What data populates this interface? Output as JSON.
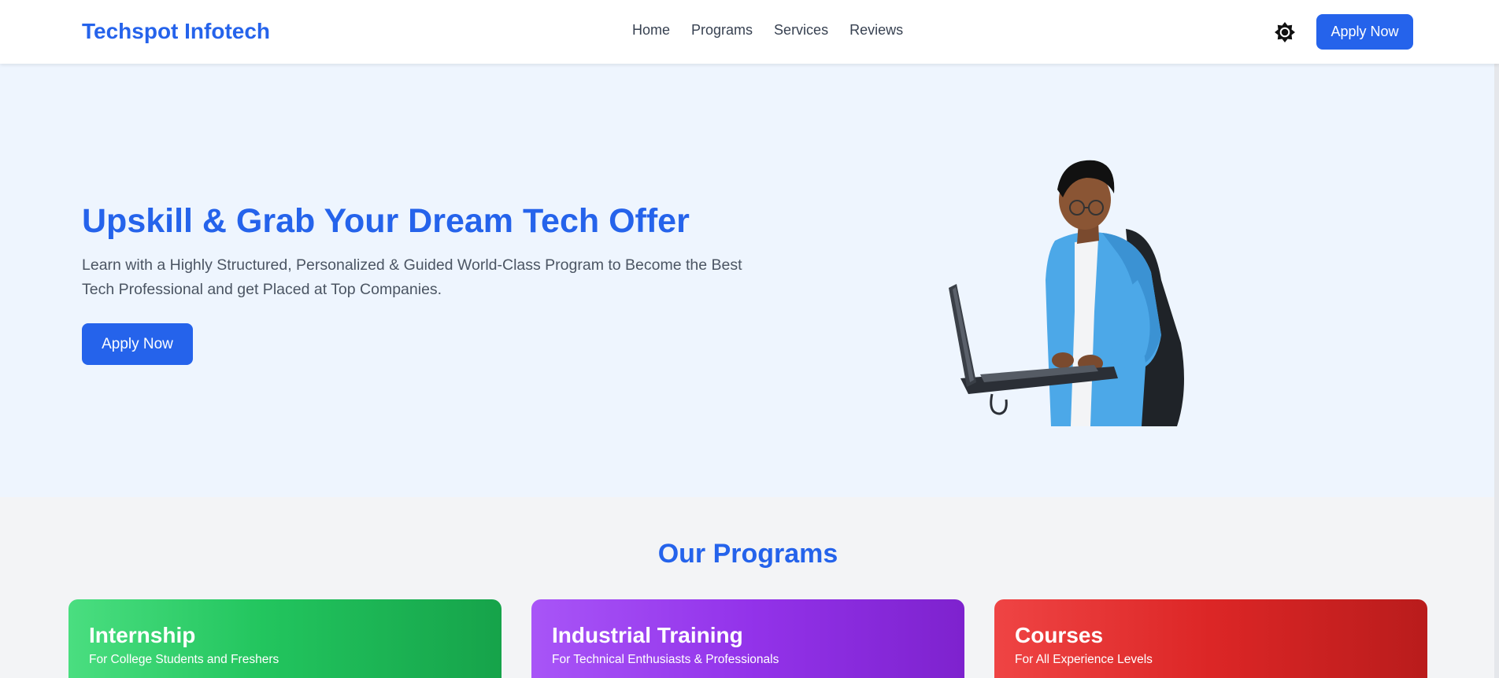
{
  "brand": "Techspot Infotech",
  "nav": {
    "links": [
      "Home",
      "Programs",
      "Services",
      "Reviews"
    ],
    "theme_icon": "sun-icon",
    "apply_label": "Apply Now"
  },
  "hero": {
    "title": "Upskill & Grab Your Dream Tech Offer",
    "subtitle": "Learn with a Highly Structured, Personalized & Guided World-Class Program to Become the Best Tech Professional and get Placed at Top Companies.",
    "apply_label": "Apply Now"
  },
  "programs": {
    "title": "Our Programs",
    "cards": [
      {
        "title": "Internship",
        "subtitle": "For College Students and Freshers"
      },
      {
        "title": "Industrial Training",
        "subtitle": "For Technical Enthusiasts & Professionals"
      },
      {
        "title": "Courses",
        "subtitle": "For All Experience Levels"
      }
    ]
  },
  "colors": {
    "primary": "#2563eb",
    "hero_bg": "#eef5fe",
    "section_bg": "#f3f4f6"
  }
}
